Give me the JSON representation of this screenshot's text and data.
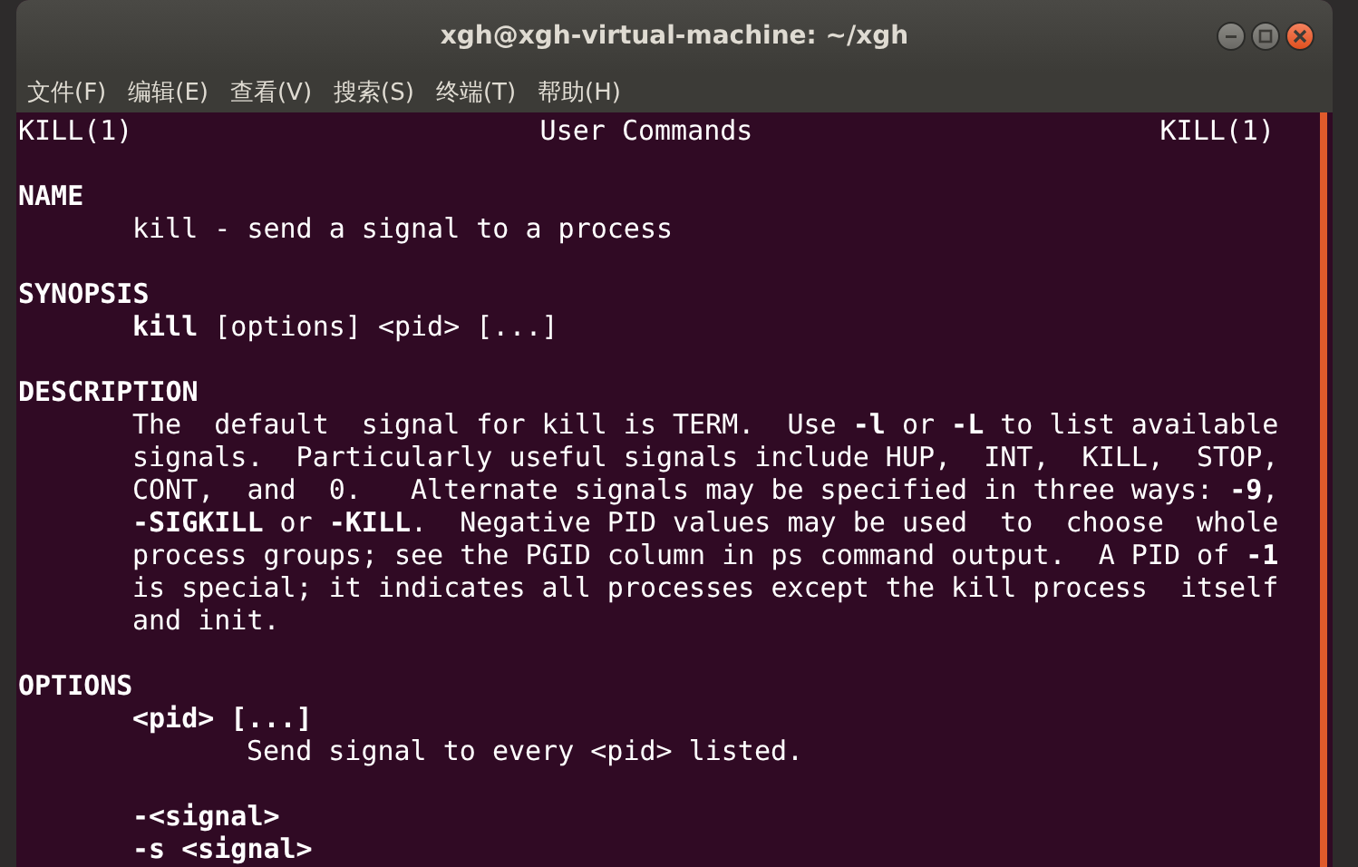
{
  "window": {
    "title": "xgh@xgh-virtual-machine: ~/xgh"
  },
  "menu": [
    {
      "label": "文件(F)"
    },
    {
      "label": "编辑(E)"
    },
    {
      "label": "查看(V)"
    },
    {
      "label": "搜索(S)"
    },
    {
      "label": "终端(T)"
    },
    {
      "label": "帮助(H)"
    }
  ],
  "header": {
    "left": "KILL(1)",
    "center": "User Commands",
    "right": "KILL(1)"
  },
  "sections": [
    {
      "heading": "NAME",
      "children": [
        {
          "lines": [
            "kill - send a signal to a process"
          ]
        }
      ]
    },
    {
      "heading": "SYNOPSIS",
      "children": [
        {
          "lines": [
            "**kill** [options] <pid> [...]"
          ]
        }
      ]
    },
    {
      "heading": "DESCRIPTION",
      "children": [
        {
          "lines": [
            "The  default  signal for kill is TERM.  Use **-l** or **-L** to list available",
            "signals.  Particularly useful signals include HUP,  INT,  KILL,  STOP,",
            "CONT,  and  0.   Alternate signals may be specified in three ways: **-9**,",
            "**-SIGKILL** or **-KILL**.  Negative PID values may be used  to  choose  whole",
            "process groups; see the PGID column in ps command output.  A PID of **-1**",
            "is special; it indicates all processes except the kill process  itself",
            "and init."
          ]
        }
      ]
    },
    {
      "heading": "OPTIONS",
      "children": [
        {
          "lines": [
            "**<pid> [...]**"
          ],
          "children": [
            {
              "lines": [
                "Send signal to every <pid> listed."
              ]
            }
          ]
        },
        {
          "lines": [
            "**-<signal>**",
            "**-s <signal>**"
          ]
        }
      ]
    }
  ]
}
